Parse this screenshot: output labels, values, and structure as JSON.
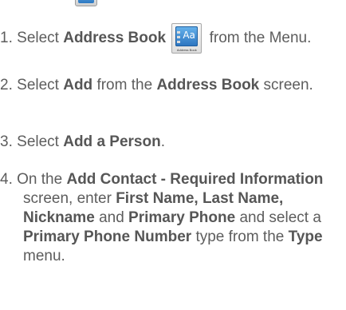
{
  "header_icon": "address-book-icon-fragment",
  "address_book_icon": {
    "glyph": "Aa",
    "caption": "Address Book"
  },
  "steps": [
    {
      "number": "1.",
      "text_1": "Select",
      "bold_1": "Address Book",
      "text_2": "from the Menu."
    },
    {
      "number": "2.",
      "text_1": "Select",
      "bold_1": "Add",
      "text_2": "from the",
      "bold_2": "Address Book",
      "text_3": "screen."
    },
    {
      "number": "3.",
      "text_1": "Select",
      "bold_1": "Add a Person",
      "text_2": "."
    },
    {
      "number": "4.",
      "text_1": "On the",
      "bold_1": "Add Contact - Required Information",
      "text_2": "screen, enter",
      "bold_2": "First Name, Last Name, Nickname",
      "text_3": "and",
      "bold_3": "Primary Phone",
      "text_4": "and select a",
      "bold_4": "Primary Phone Number",
      "text_5": "type from the",
      "bold_5": "Type",
      "text_6": "menu."
    }
  ]
}
